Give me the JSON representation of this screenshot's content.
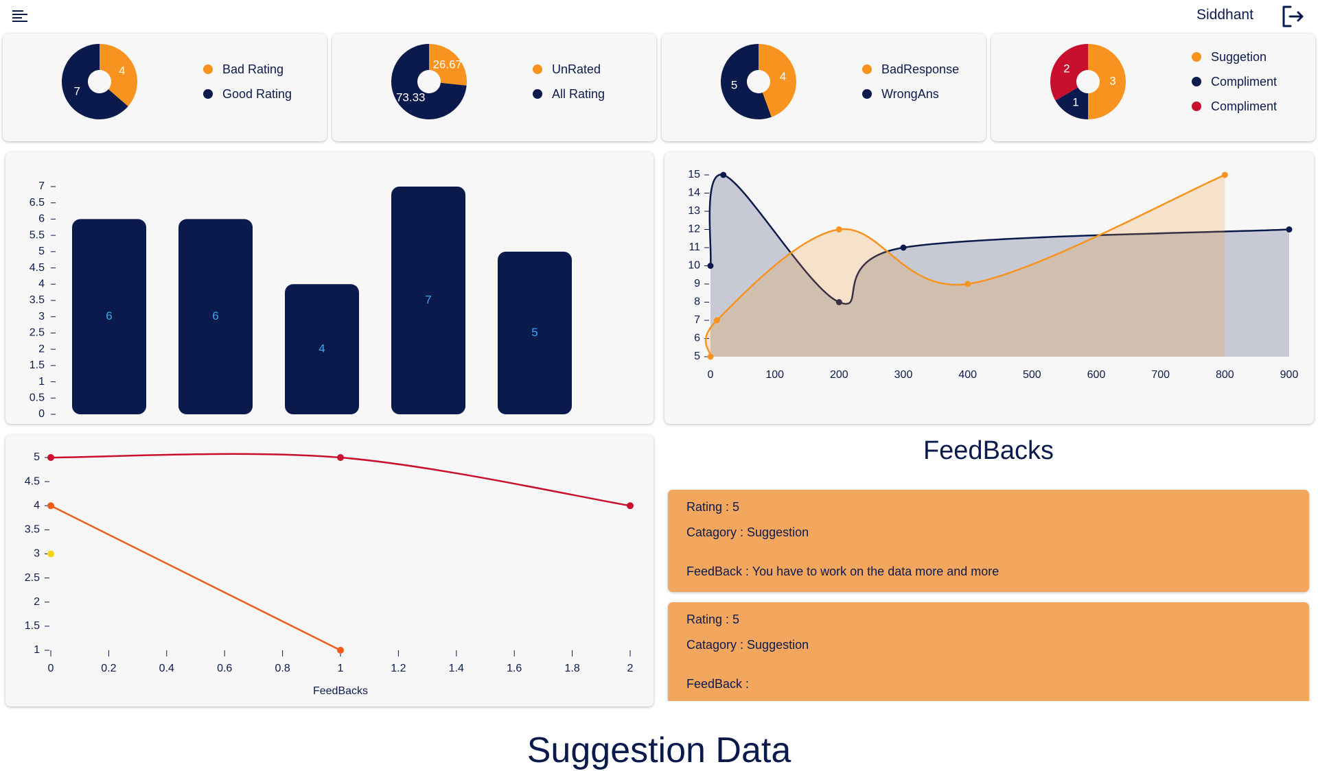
{
  "header": {
    "username": "Siddhant"
  },
  "pies": [
    {
      "legend": [
        "Bad Rating",
        "Good Rating"
      ],
      "slices": [
        {
          "value": 4,
          "label": "4",
          "color": "#f7931e"
        },
        {
          "value": 7,
          "label": "7",
          "color": "#0b1a4d"
        }
      ]
    },
    {
      "legend": [
        "UnRated",
        "All Rating"
      ],
      "slices": [
        {
          "value": 26.67,
          "label": "26.67",
          "color": "#f7931e"
        },
        {
          "value": 73.33,
          "label": "73.33",
          "color": "#0b1a4d"
        }
      ]
    },
    {
      "legend": [
        "BadResponse",
        "WrongAns"
      ],
      "slices": [
        {
          "value": 4,
          "label": "4",
          "color": "#f7931e"
        },
        {
          "value": 5,
          "label": "5",
          "color": "#0b1a4d"
        }
      ]
    },
    {
      "legend": [
        "Suggetion",
        "Compliment",
        "Compliment"
      ],
      "slices": [
        {
          "value": 3,
          "label": "3",
          "color": "#f7931e"
        },
        {
          "value": 1,
          "label": "1",
          "color": "#0b1a4d"
        },
        {
          "value": 2,
          "label": "2",
          "color": "#c8102e"
        }
      ]
    }
  ],
  "colors": {
    "orange": "#f7931e",
    "navy": "#0b1a4d",
    "crimson": "#c8102e",
    "red_orange": "#f05a1a",
    "yellow": "#f5d31c",
    "card_bg": "#f7f7f7",
    "feedback_bg": "#f2a65e",
    "bar_label": "#38a8f5"
  },
  "chart_data": [
    {
      "type": "bar",
      "values": [
        6,
        6,
        4,
        7,
        5
      ],
      "ylim": [
        0,
        7
      ],
      "yticks": [
        "0",
        "0.5",
        "1",
        "1.5",
        "2",
        "2.5",
        "3",
        "3.5",
        "4",
        "4.5",
        "5",
        "5.5",
        "6",
        "6.5",
        "7"
      ]
    },
    {
      "type": "area",
      "series": [
        {
          "color": "#0b1a4d",
          "x": [
            0,
            20,
            200,
            300,
            900
          ],
          "y": [
            10,
            15,
            8,
            11,
            12
          ]
        },
        {
          "color": "#f7931e",
          "x": [
            0,
            10,
            200,
            400,
            800
          ],
          "y": [
            5,
            7,
            12,
            9,
            15
          ]
        }
      ],
      "xlim": [
        0,
        900
      ],
      "ylim": [
        5,
        15
      ],
      "xticks": [
        "0",
        "100",
        "200",
        "300",
        "400",
        "500",
        "600",
        "700",
        "800",
        "900"
      ],
      "yticks": [
        "5",
        "6",
        "7",
        "8",
        "9",
        "10",
        "11",
        "12",
        "13",
        "14",
        "15"
      ]
    },
    {
      "type": "line",
      "xlabel": "FeedBacks",
      "series": [
        {
          "color": "#c8102e",
          "x": [
            0,
            1,
            2
          ],
          "y": [
            5,
            5,
            4
          ]
        },
        {
          "color": "#f05a1a",
          "x": [
            0,
            1
          ],
          "y": [
            4,
            1
          ]
        },
        {
          "color": "#f5d31c",
          "x": [
            0
          ],
          "y": [
            3
          ]
        }
      ],
      "xlim": [
        0,
        2
      ],
      "ylim": [
        1,
        5
      ],
      "xticks": [
        "0",
        "0.2",
        "0.4",
        "0.6",
        "0.8",
        "1",
        "1.2",
        "1.4",
        "1.6",
        "1.8",
        "2"
      ],
      "yticks": [
        "1",
        "1.5",
        "2",
        "2.5",
        "3",
        "3.5",
        "4",
        "4.5",
        "5"
      ]
    }
  ],
  "feedbacks": {
    "title": "FeedBacks",
    "items": [
      {
        "rating": "Rating : 5",
        "category": "Catagory : Suggestion",
        "feedback": "FeedBack : You have to work on the data more and more"
      },
      {
        "rating": "Rating : 5",
        "category": "Catagory : Suggestion",
        "feedback": "FeedBack :"
      }
    ]
  },
  "section_title": "Suggestion Data"
}
